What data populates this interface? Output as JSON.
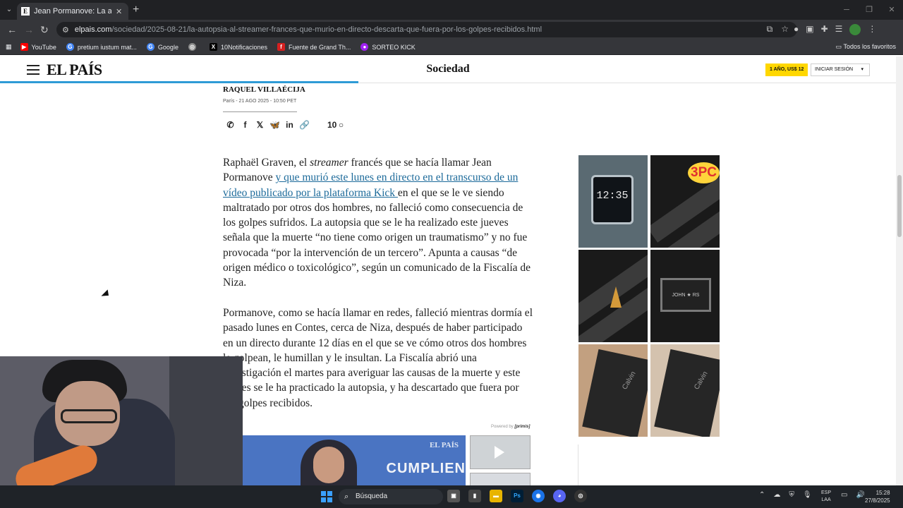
{
  "browser": {
    "tab_title": "Jean Pormanove: La autopsia al",
    "tab_favicon": "E",
    "url_host": "elpais.com",
    "url_path": "/sociedad/2025-08-21/la-autopsia-al-streamer-frances-que-murio-en-directo-descarta-que-fuera-por-los-golpes-recibidos.html",
    "bookmarks": [
      {
        "label": "YouTube",
        "icon": "youtube-icon",
        "color": "#ff0000"
      },
      {
        "label": "pretium iustum mat...",
        "icon": "google-icon",
        "color": "#4285f4"
      },
      {
        "label": "Google",
        "icon": "google-icon",
        "color": "#4285f4"
      },
      {
        "label": "",
        "icon": "globe-icon",
        "color": "#888888"
      },
      {
        "label": "10Notificaciones",
        "icon": "x-icon",
        "color": "#000000"
      },
      {
        "label": "Fuente de Grand Th...",
        "icon": "f-icon",
        "color": "#d62020"
      },
      {
        "label": "SORTEO KICK",
        "icon": "kick-icon",
        "color": "#a020f0"
      }
    ],
    "all_bookmarks_label": "Todos los favoritos"
  },
  "site": {
    "logo": "EL PAÍS",
    "section": "Sociedad",
    "subscribe_label": "1 AÑO, US$ 12",
    "login_label": "INICIAR SESIÓN",
    "accent_color": "#ffd700",
    "progress_color": "#2f9bd6"
  },
  "article": {
    "author": "RAQUEL VILLAÉCIJA",
    "dateline": "París - 21 AGO 2025 - 10:50 PET",
    "comment_count": "10",
    "share_icons": [
      "whatsapp-icon",
      "facebook-icon",
      "x-icon",
      "bluesky-icon",
      "linkedin-icon",
      "link-icon"
    ],
    "p1_a": "Raphaël Graven, el ",
    "p1_em": "streamer",
    "p1_b": " francés que se hacía llamar Jean Pormanove ",
    "p1_link": "y que murió este lunes en directo en el transcurso de un vídeo publicado por la plataforma Kick ",
    "p1_c": "en el que se le ve siendo maltratado por otros dos hombres, no falleció como consecuencia de los golpes sufridos. La autopsia que se le ha realizado este jueves señala que la muerte “no tiene como origen un traumatismo” y no fue provocada “por la intervención de un tercero”. Apunta a causas “de origen médico o toxicológico”, según un comunicado de la Fiscalía de Niza.",
    "p2": "Pormanove, como se hacía llamar en redes, falleció mientras dormía el pasado lunes en Contes, cerca de Niza, después de haber participado en un directo durante 12 días en el que se ve cómo otros dos hombres le golpean, le humillan y le insultan. La Fiscalía abrió una investigación el martes para averiguar las causas de la muerte y este jueves se le ha practicado la autopsia, y ha descartado que fuera por los golpes recibidos.",
    "link_color": "#1c6a9a"
  },
  "video": {
    "powered_prefix": "Powered by",
    "powered_brand": "[primis]",
    "brand": "EL PAÍS",
    "caption": "CUMPLIEN"
  },
  "ad": {
    "watch_time": "12:35",
    "badge": "3PC",
    "buckle_text": "JOHN ★ RS",
    "calvin": "Calvin"
  },
  "taskbar": {
    "search_label": "Búsqueda",
    "lang_top": "ESP",
    "lang_bottom": "LAA",
    "time": "15:28",
    "date": "27/8/2025"
  }
}
